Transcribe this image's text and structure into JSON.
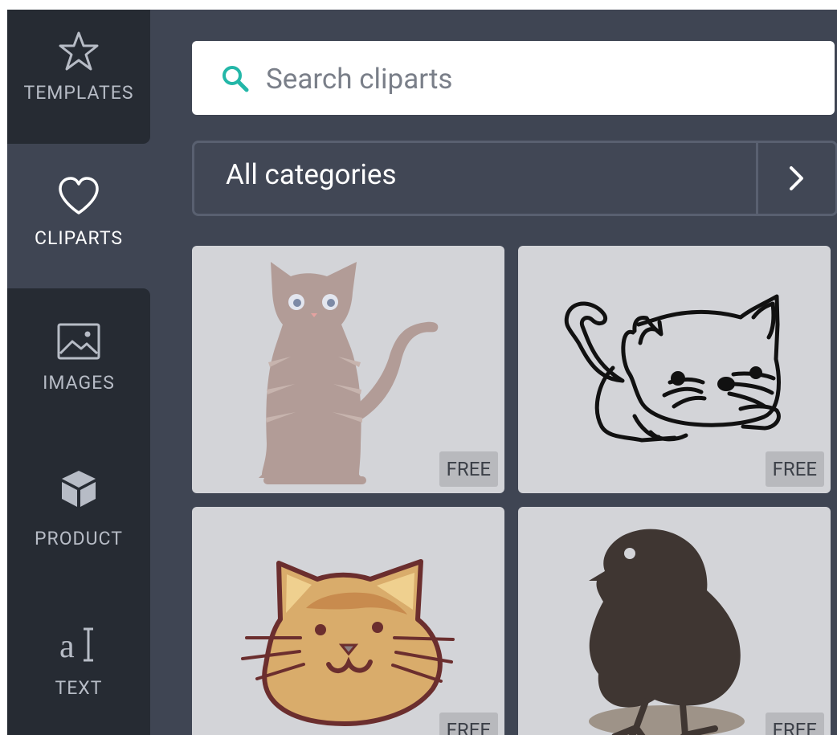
{
  "sidebar": {
    "items": [
      {
        "label": "TEMPLATES",
        "icon": "star-icon"
      },
      {
        "label": "CLIPARTS",
        "icon": "heart-icon"
      },
      {
        "label": "IMAGES",
        "icon": "image-icon"
      },
      {
        "label": "PRODUCT",
        "icon": "cube-icon"
      },
      {
        "label": "TEXT",
        "icon": "text-cursor-icon"
      }
    ]
  },
  "search": {
    "placeholder": "Search cliparts",
    "icon": "search-icon"
  },
  "category": {
    "label": "All categories",
    "icon": "chevron-right-icon"
  },
  "cliparts": [
    {
      "subject": "Standing tabby cat",
      "badge": "FREE"
    },
    {
      "subject": "Outlined crouching kitten",
      "badge": "FREE"
    },
    {
      "subject": "Cartoon cat face",
      "badge": "FREE"
    },
    {
      "subject": "Silhouette chick",
      "badge": "FREE"
    }
  ],
  "colors": {
    "accent": "#23b7a8",
    "rail": "#262b33",
    "panel": "#3f4553",
    "tile": "#d3d4d8"
  }
}
